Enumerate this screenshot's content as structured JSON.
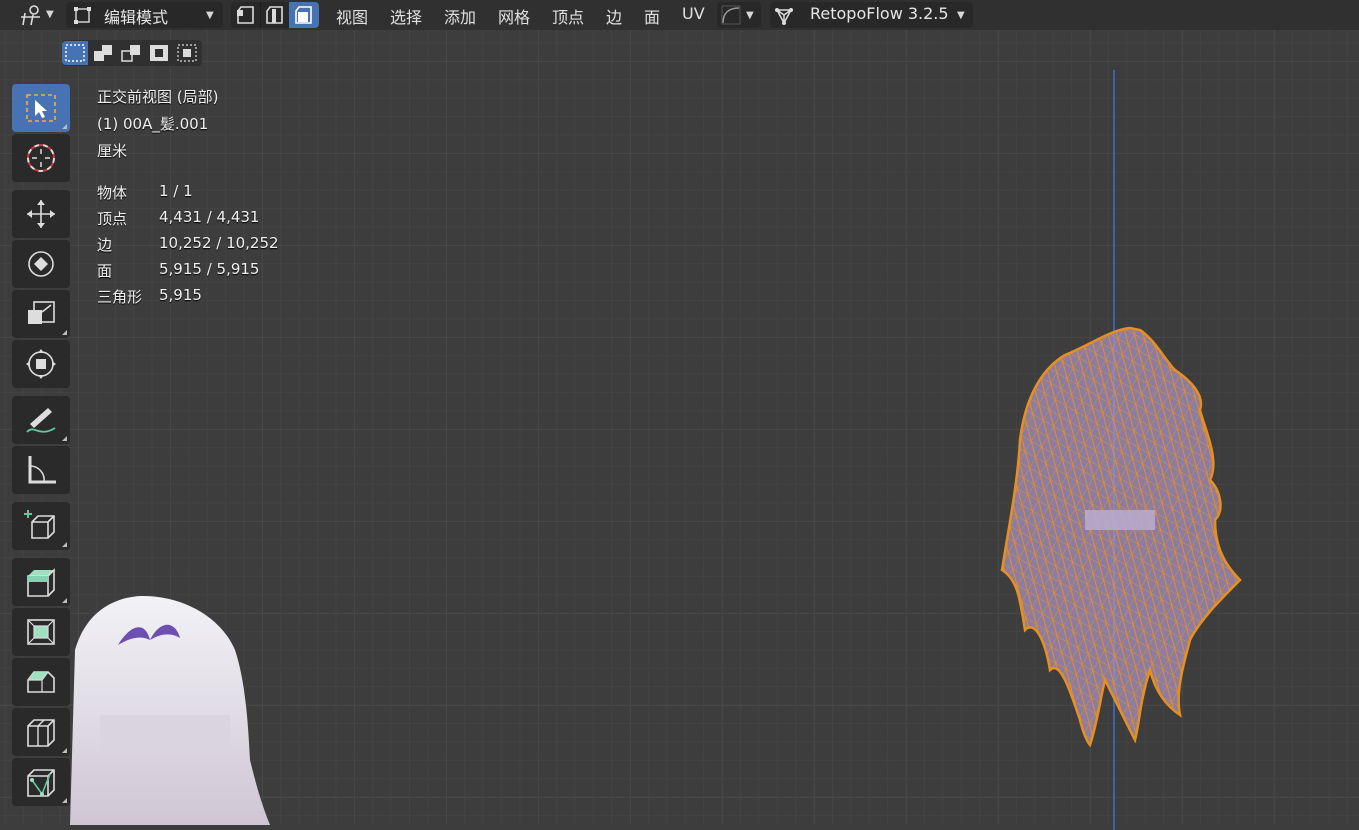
{
  "header": {
    "mode_label": "编辑模式",
    "menu": [
      "视图",
      "选择",
      "添加",
      "网格",
      "顶点",
      "边",
      "面",
      "UV"
    ],
    "addon_label": "RetopoFlow 3.2.5"
  },
  "overlay": {
    "view_name": "正交前视图 (局部)",
    "object_name": "(1) 00A_髪.001",
    "units": "厘米",
    "stats": [
      {
        "label": "物体",
        "value": "1 / 1"
      },
      {
        "label": "顶点",
        "value": "4,431 / 4,431"
      },
      {
        "label": "边",
        "value": "10,252 / 10,252"
      },
      {
        "label": "面",
        "value": "5,915 / 5,915"
      },
      {
        "label": "三角形",
        "value": "5,915"
      }
    ]
  },
  "toolbar": {
    "tools": [
      "select-box-icon",
      "cursor-icon",
      "move-icon",
      "rotate-icon",
      "scale-icon",
      "transform-icon",
      "annotate-icon",
      "measure-icon",
      "add-cube-icon",
      "extrude-icon",
      "inset-icon",
      "bevel-icon",
      "loop-cut-icon",
      "knife-icon"
    ],
    "active": "select-box-icon"
  },
  "colors": {
    "accent": "#4772b3",
    "wire": "#e8901f",
    "axis": "#3c66b7"
  }
}
